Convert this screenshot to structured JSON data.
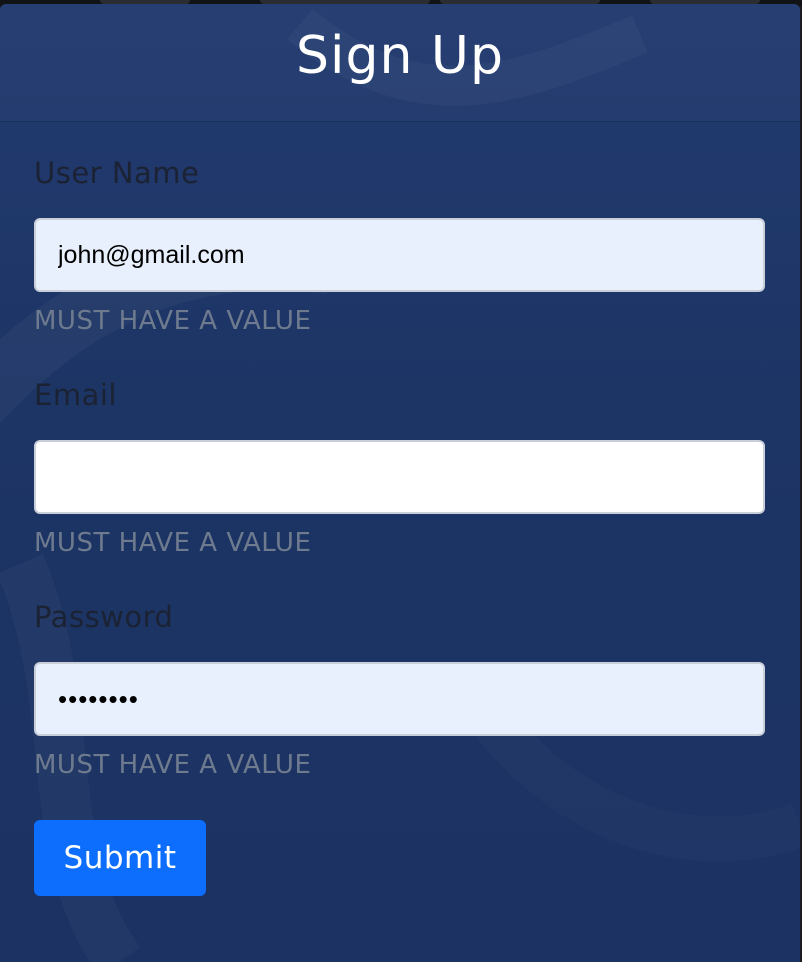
{
  "form": {
    "title": "Sign Up",
    "fields": [
      {
        "label": "User Name",
        "value": "john@gmail.com",
        "type": "text",
        "error": "MUST HAVE A VALUE"
      },
      {
        "label": "Email",
        "value": "",
        "type": "email",
        "error": "MUST HAVE A VALUE"
      },
      {
        "label": "Password",
        "value": "********",
        "type": "password",
        "error": "MUST HAVE A VALUE"
      }
    ],
    "submit_label": "Submit"
  },
  "colors": {
    "card_background": "#1d3565",
    "autofill_background": "#e8f0fe",
    "submit_button": "#0d6efd",
    "error_text": "#6e7a8e",
    "label_text": "#1b2233"
  }
}
